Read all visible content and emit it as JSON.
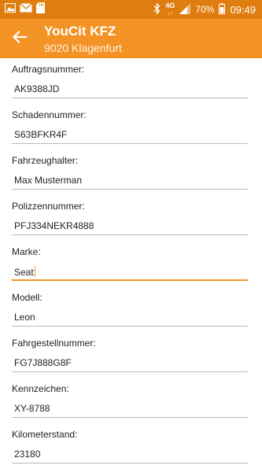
{
  "status_bar": {
    "icons_left": [
      "photo-icon",
      "mail-icon",
      "sd-card-icon"
    ],
    "icons_right": [
      "bluetooth-icon",
      "network-4g-icon",
      "signal-icon"
    ],
    "network": "4G",
    "battery": "70%",
    "time": "09:49"
  },
  "app_bar": {
    "title": "YouCit KFZ",
    "subtitle": "9020 Klagenfurt",
    "accent_color": "#f49325",
    "status_color": "#e07d10"
  },
  "fields": [
    {
      "label": "Auftragsnummer:",
      "value": "AK9388JD"
    },
    {
      "label": "Schadennummer:",
      "value": "S63BFKR4F"
    },
    {
      "label": "Fahrzeughalter:",
      "value": "Max Musterman"
    },
    {
      "label": "Polizzennummer:",
      "value": "PFJ334NEKR4888"
    },
    {
      "label": "Marke:",
      "value": "Seat",
      "focused": true
    },
    {
      "label": "Modell:",
      "value": "Leon"
    },
    {
      "label": "Fahrgestellnummer:",
      "value": "FG7J888G8F"
    },
    {
      "label": "Kennzeichen:",
      "value": "XY-8788"
    },
    {
      "label": "Kilometerstand:",
      "value": "23180"
    }
  ]
}
